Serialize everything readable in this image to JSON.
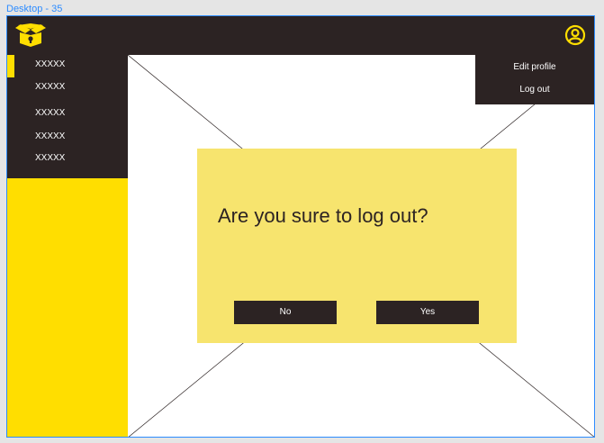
{
  "frame": {
    "label": "Desktop - 35"
  },
  "colors": {
    "dark": "#2c2323",
    "brand_yellow": "#ffde00",
    "dialog_yellow": "#f7e46e",
    "selection_blue": "#2d8cff"
  },
  "topbar": {
    "logo_icon": "box-logo-icon",
    "user_icon": "user-circle-icon"
  },
  "sidebar": {
    "items": [
      {
        "label": "XXXXX"
      },
      {
        "label": "XXXXX"
      },
      {
        "label": "XXXXX"
      },
      {
        "label": "XXXXX"
      },
      {
        "label": "XXXXX"
      }
    ]
  },
  "user_menu": {
    "edit_profile": "Edit profile",
    "log_out": "Log out"
  },
  "dialog": {
    "title": "Are you sure to log out?",
    "no_label": "No",
    "yes_label": "Yes"
  }
}
